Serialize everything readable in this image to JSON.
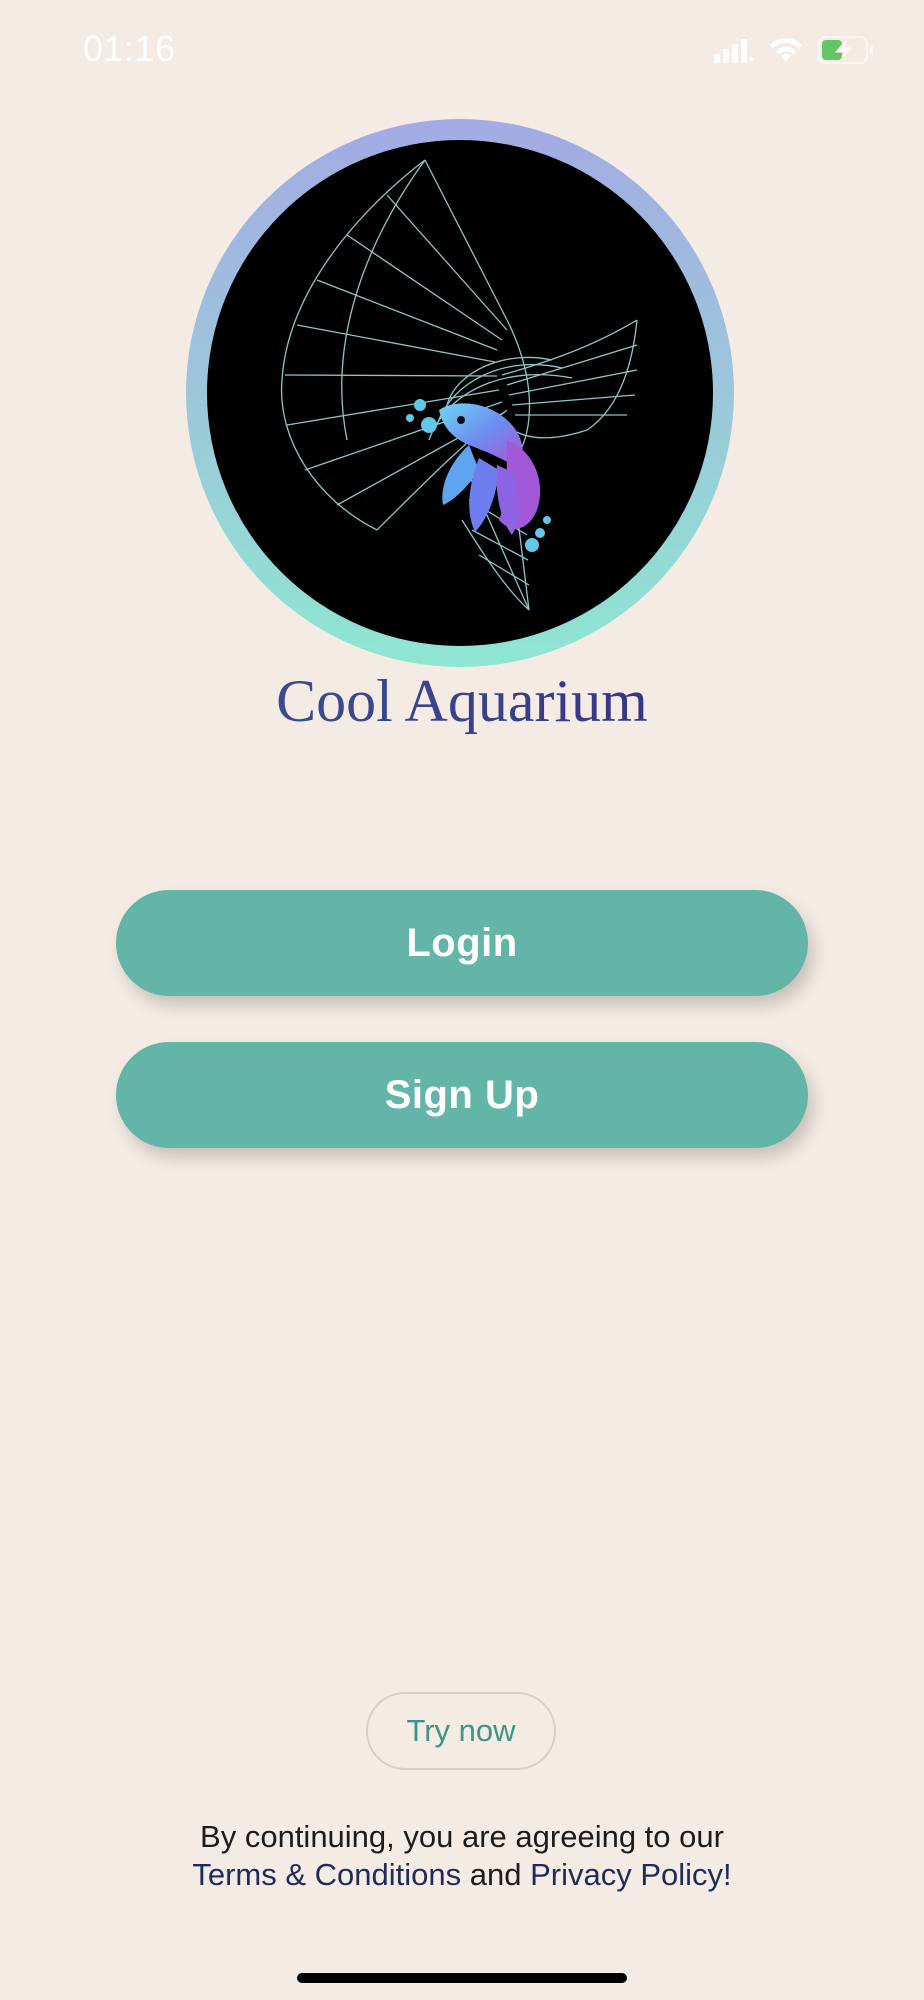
{
  "status_bar": {
    "time": "01:16",
    "icons": [
      "cellular-signal-icon",
      "wifi-icon",
      "battery-charging-icon"
    ],
    "battery_color": "#65C466"
  },
  "brand": {
    "name": "Cool Aquarium",
    "logo_icon": "betta-fish-logo-icon",
    "ring_colors": [
      "#A3ABE4",
      "#8EE6D1"
    ]
  },
  "actions": {
    "login_label": "Login",
    "signup_label": "Sign Up",
    "try_label": "Try now",
    "button_color": "#63B6A7"
  },
  "legal": {
    "prefix": "By continuing, you are agreeing to our",
    "terms_label": "Terms & Conditions",
    "joiner": "and",
    "privacy_label": "Privacy Policy!"
  }
}
